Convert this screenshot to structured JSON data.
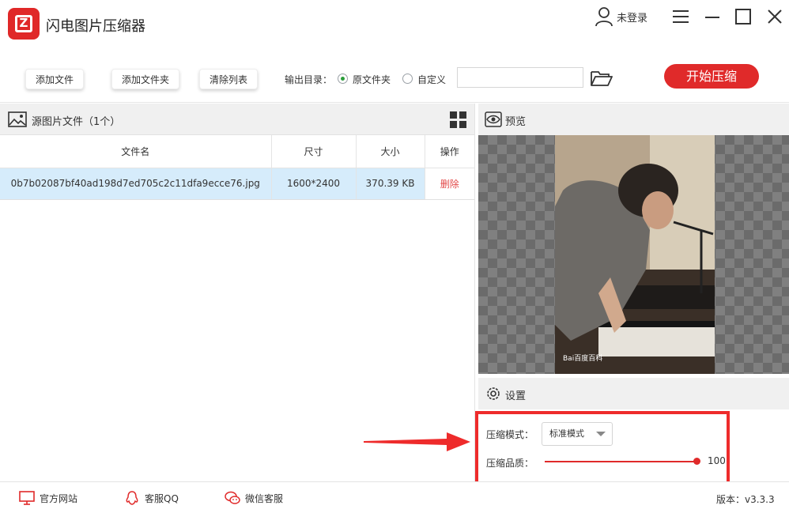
{
  "app": {
    "title": "闪电图片压缩器"
  },
  "user": {
    "label": "未登录"
  },
  "toolbar": {
    "add_file": "添加文件",
    "add_folder": "添加文件夹",
    "clear_list": "清除列表",
    "output_label": "输出目录：",
    "option_original": "原文件夹",
    "option_custom": "自定义",
    "path_value": "",
    "start": "开始压缩"
  },
  "file_panel": {
    "title": "源图片文件（1个）",
    "columns": [
      "文件名",
      "尺寸",
      "大小",
      "操作"
    ],
    "rows": [
      {
        "name": "0b7b02087bf40ad198d7ed705c2c11dfa9ecce76.jpg",
        "size": "1600*2400",
        "filesize": "370.39 KB",
        "action": "删除"
      }
    ]
  },
  "preview": {
    "title": "预览",
    "watermark": "Bai百度百科"
  },
  "settings": {
    "title": "设置",
    "mode_label": "压缩模式：",
    "mode_value": "标准模式",
    "quality_label": "压缩品质：",
    "quality_value": "100",
    "quality_fraction": 1.0
  },
  "footer": {
    "website": "官方网站",
    "qq": "客服QQ",
    "wechat": "微信客服",
    "version": "版本：v3.3.3"
  },
  "colors": {
    "accent": "#e02a2a",
    "selected_row": "#d6ecfb",
    "radio_checked": "#2a9d3a"
  }
}
